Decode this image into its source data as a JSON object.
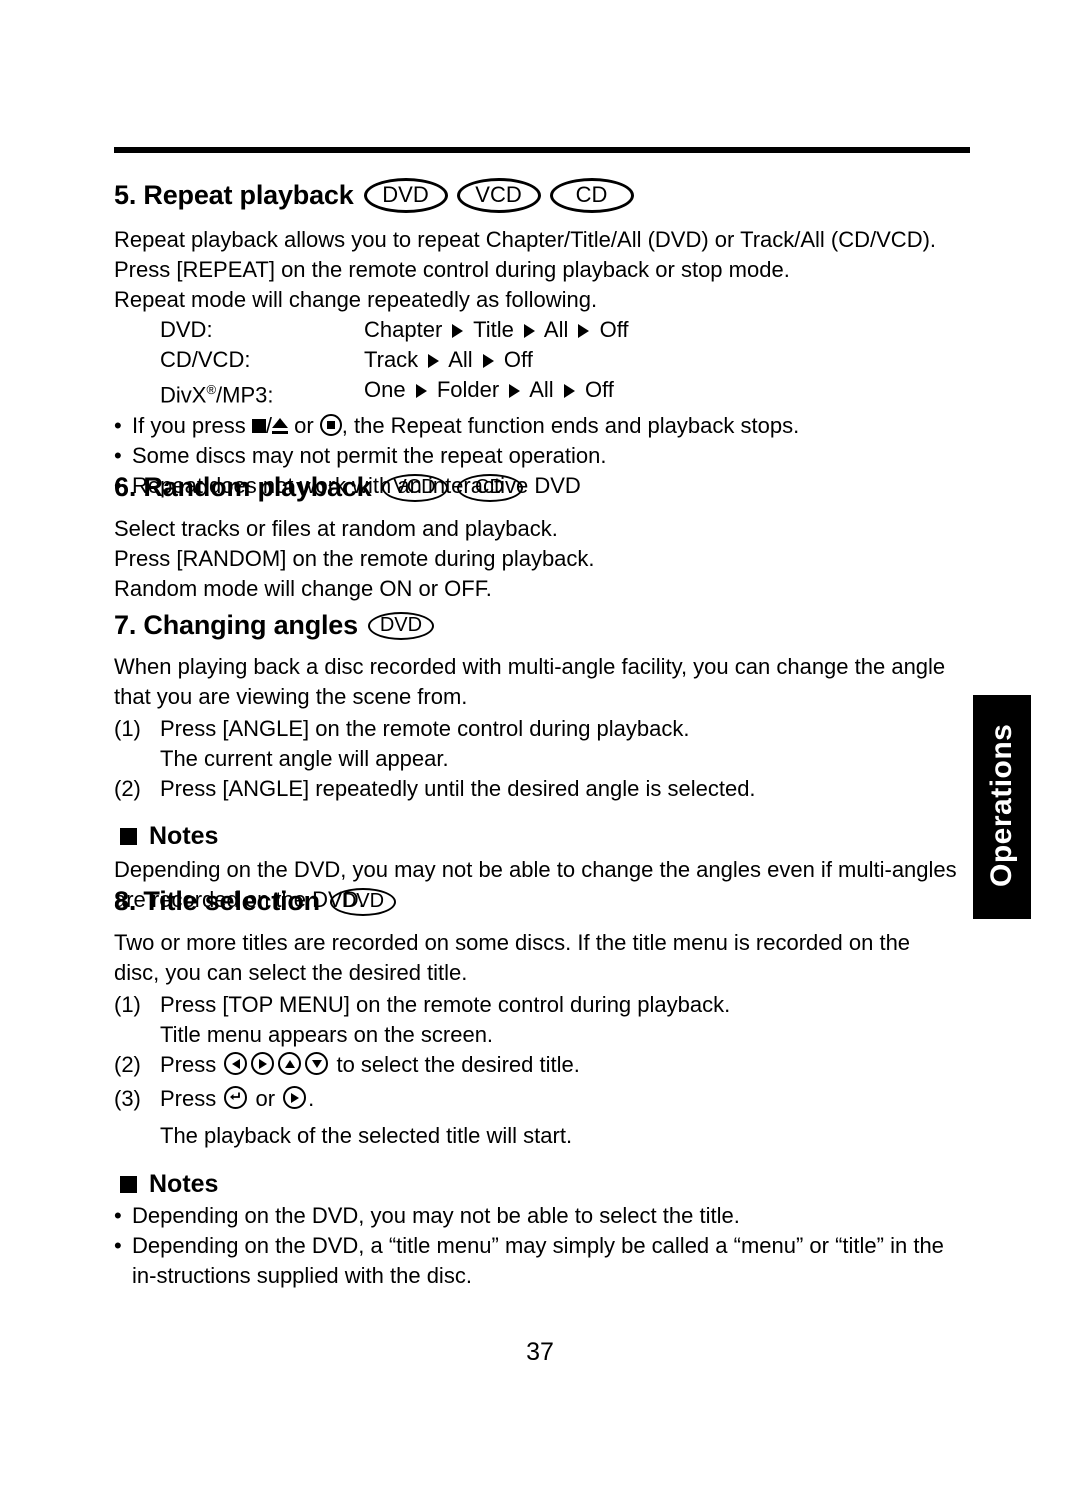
{
  "page": {
    "number": "37",
    "side_tab_label": "Operations"
  },
  "sections": [
    {
      "id": "repeat-playback",
      "heading": "5. Repeat playback",
      "badges": [
        "DVD",
        "VCD",
        "CD"
      ],
      "lines": [
        "Repeat playback allows you to repeat Chapter/Title/All (DVD) or Track/All (CD/VCD).",
        "Press [REPEAT] on the remote control during playback or stop mode.",
        "Repeat mode will change repeatedly as following."
      ],
      "modes": [
        {
          "label": "DVD:",
          "steps": [
            "Chapter",
            "Title",
            "All",
            "Off"
          ]
        },
        {
          "label": "CD/VCD:",
          "steps": [
            "Track",
            "All",
            "Off"
          ]
        },
        {
          "label": "DivX",
          "label_sup": "®",
          "label_tail": "/MP3:",
          "steps": [
            "One",
            "Folder",
            "All",
            "Off"
          ]
        }
      ],
      "bullets": [
        {
          "pre": "If you press ",
          "mid": " or ",
          "post": ", the Repeat function ends and playback stops."
        },
        {
          "text": "Some discs may not permit the repeat operation."
        },
        {
          "text": "Repeat does not work with an interactive DVD"
        }
      ]
    },
    {
      "id": "random-playback",
      "heading": "6. Random playback",
      "badges": [
        "VCD",
        "CD"
      ],
      "lines": [
        "Select tracks or files at random and playback.",
        "Press [RANDOM] on the remote during playback.",
        "Random mode will change ON or OFF."
      ]
    },
    {
      "id": "changing-angles",
      "heading": "7. Changing angles",
      "badges": [
        "DVD"
      ],
      "intro": "When playing back a disc recorded with multi-angle facility, you can change the angle that you are viewing the scene from.",
      "steps": [
        {
          "num": "(1)",
          "text": "Press [ANGLE] on the remote control during playback."
        },
        {
          "num": "",
          "text": "The current angle will appear."
        },
        {
          "num": "(2)",
          "text": "Press [ANGLE] repeatedly until the desired angle is selected."
        }
      ],
      "notes_heading": "Notes",
      "notes_text": "Depending on the DVD, you may not be able to change the angles even if multi-angles are recorded on the DVD."
    },
    {
      "id": "title-selection",
      "heading": "8. Title selection",
      "badges": [
        "DVD"
      ],
      "intro": "Two or more titles are recorded on some discs. If the title menu is recorded on the disc, you can select the desired title.",
      "steps": [
        {
          "num": "(1)",
          "text": "Press [TOP MENU] on the remote control during playback."
        },
        {
          "num": "",
          "text": "Title menu appears on the screen."
        },
        {
          "num": "(2)",
          "pre": "Press ",
          "post": " to select the desired title."
        },
        {
          "num": "(3)",
          "pre": "Press ",
          "mid": " or ",
          "post": "."
        },
        {
          "num": "",
          "text": "The playback of the selected title will start."
        }
      ],
      "notes_heading": "Notes",
      "notes_bullets": [
        "Depending on the DVD, you may not be able to select the title.",
        "Depending on the DVD, a “title menu” may simply be called a “menu” or “title” in the in-structions supplied with the disc."
      ]
    }
  ],
  "icons": {
    "stop": "stop-square-icon",
    "eject": "eject-icon",
    "record_circle": "circled-square-icon",
    "arrow_left": "left-arrow-key-icon",
    "arrow_right": "right-arrow-key-icon",
    "arrow_up": "up-arrow-key-icon",
    "arrow_down": "down-arrow-key-icon",
    "enter": "enter-key-icon",
    "play": "play-key-icon",
    "step_arrow": "solid-right-triangle-icon",
    "bullet": "•",
    "slash": "/"
  }
}
